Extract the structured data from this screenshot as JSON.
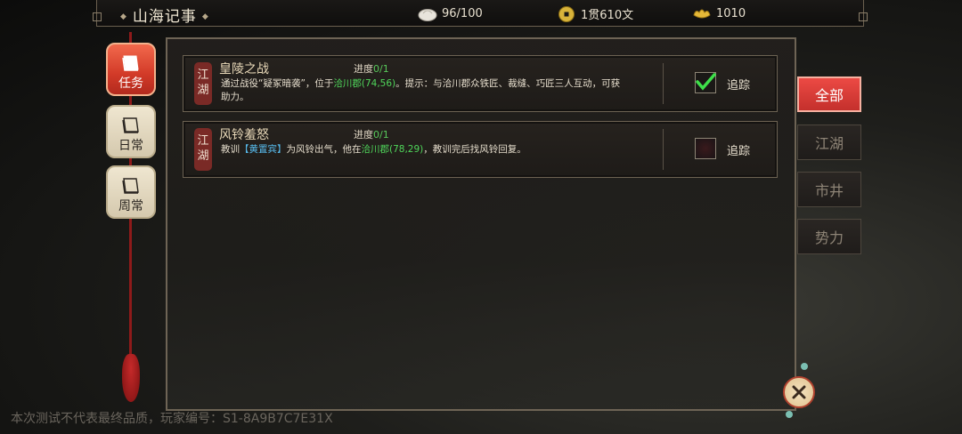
{
  "header": {
    "title": "山海记事",
    "resources": [
      {
        "icon": "bun-icon",
        "value": "96/100"
      },
      {
        "icon": "copper-coin-icon",
        "value": "1贯610文"
      },
      {
        "icon": "gold-ingot-icon",
        "value": "1010"
      }
    ]
  },
  "sidebar": {
    "items": [
      {
        "label": "任务",
        "active": true
      },
      {
        "label": "日常",
        "active": false
      },
      {
        "label": "周常",
        "active": false
      }
    ]
  },
  "quests": [
    {
      "tag": "江湖",
      "name": "皇陵之战",
      "progress_label": "进度",
      "progress": "0/1",
      "desc_a": "通过战役“疑冢暗袭”，位于",
      "desc_loc": "洽川郡(74,56)",
      "desc_b": "。提示：与洽川郡众铁匠、裁缝、巧匠三人互动，可获助力。",
      "tracked": true,
      "track_label": "追踪"
    },
    {
      "tag": "江湖",
      "name": "风铃羞怒",
      "progress_label": "进度",
      "progress": "0/1",
      "desc_a": "教训",
      "desc_npc": "【黄置宾】",
      "desc_b": "为风铃出气，他在",
      "desc_loc": "洽川郡(78,29)",
      "desc_c": "，教训完后找风铃回复。",
      "tracked": false,
      "track_label": "追踪"
    }
  ],
  "filter_tabs": [
    {
      "label": "全部",
      "active": true
    },
    {
      "label": "江湖",
      "active": false
    },
    {
      "label": "市井",
      "active": false
    },
    {
      "label": "势力",
      "active": false
    }
  ],
  "footer": {
    "text": "本次测试不代表最终品质，玩家编号：S1-8A9B7C7E31X"
  },
  "colors": {
    "accent_red": "#d23a28",
    "location_green": "#4fd55a",
    "npc_cyan": "#56b8e8"
  }
}
